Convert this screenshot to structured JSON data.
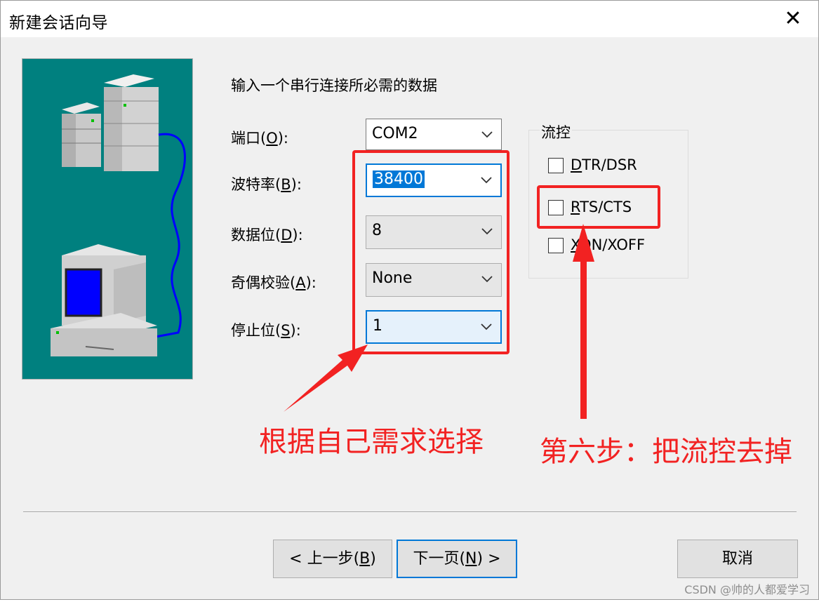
{
  "window": {
    "title": "新建会话向导",
    "close_glyph": "✕"
  },
  "form": {
    "intro": "输入一个串行连接所必需的数据",
    "fields": [
      {
        "label_pre": "端口(",
        "label_key": "O",
        "label_post": "):",
        "value": "COM2"
      },
      {
        "label_pre": "波特率(",
        "label_key": "B",
        "label_post": "):",
        "value": "38400"
      },
      {
        "label_pre": "数据位(",
        "label_key": "D",
        "label_post": "):",
        "value": "8"
      },
      {
        "label_pre": "奇偶校验(",
        "label_key": "A",
        "label_post": "):",
        "value": "None"
      },
      {
        "label_pre": "停止位(",
        "label_key": "S",
        "label_post": "):",
        "value": "1"
      }
    ]
  },
  "flow_control": {
    "title": "流控",
    "options": [
      {
        "key": "D",
        "rest": "TR/DSR",
        "checked": false
      },
      {
        "key": "R",
        "rest": "TS/CTS",
        "checked": false
      },
      {
        "key": "X",
        "rest": "ON/XOFF",
        "checked": false
      }
    ]
  },
  "annotations": {
    "left_note": "根据自己需求选择",
    "right_note": "第六步：把流控去掉",
    "color": "#f22222"
  },
  "buttons": {
    "back_pre": "< 上一步(",
    "back_key": "B",
    "back_post": ")",
    "next_pre": "下一页(",
    "next_key": "N",
    "next_post": ") >",
    "cancel": "取消"
  },
  "watermark": "CSDN @帅的人都爱学习",
  "icons": {
    "close": "close-icon",
    "dropdown": "chevron-down-icon",
    "illustration": "server-computer-illustration"
  }
}
